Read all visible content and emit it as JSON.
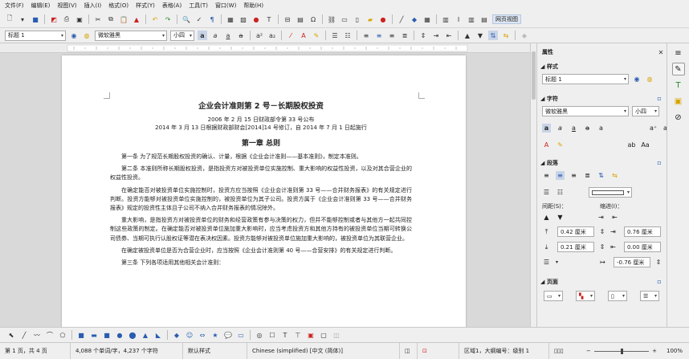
{
  "menu": [
    "文件(F)",
    "编辑(E)",
    "视图(V)",
    "插入(I)",
    "格式(O)",
    "样式(Y)",
    "表格(A)",
    "工具(T)",
    "窗口(W)",
    "帮助(H)"
  ],
  "toolbar": {
    "web_view_label": "网页视图"
  },
  "formatting": {
    "paragraph_style": "标题 1",
    "font_name": "微软雅黑",
    "font_size": "小四"
  },
  "document": {
    "title": "企业会计准则第 2 号－长期股权投资",
    "subtitle1": "2006 年 2 月 15 日财政部令第 33 号公布",
    "subtitle2": "2014 年 3 月 13 日根据财政部财会[2014]14 号修订，自 2014 年 7 月 1 日起施行",
    "chapter": "第一章 总则",
    "paragraphs": [
      "第一条 为了规范长期股权投资的确认、计量，根据《企业会计准则——基本准则》，制定本准则。",
      "第二条 本准则所称长期股权投资，是指投资方对被投资单位实施控制、重大影响的权益性投资，以及对其合营企业的权益性投资。",
      "在确定能否对被投资单位实施控制时，投资方应当按照《企业会计准则第 33 号——合并财务报表》的有关规定进行判断。投资方能够对被投资单位实施控制的，被投资单位为其子公司。投资方属于《企业会计准则第 33 号——合并财务报表》规定的投资性主体且子公司不纳入合并财务报表的情况除外。",
      "重大影响，是指投资方对被投资单位的财务和经营政策有参与决策的权力，但并不能够控制或者与其他方一起共同控制这些政策的制定。在确定能否对被投资单位施加重大影响时，应当考虑投资方和其他方持有的被投资单位当期可转换公司债券、当期可执行认股权证等潜在表决权因素。投资方能够对被投资单位施加重大影响的，被投资单位为其联营企业。",
      "在确定被投资单位是否为合营企业时，应当按照《企业会计准则第 40 号——合营安排》的有关规定进行判断。",
      "第三条 下列各项适用其他相关会计准则："
    ]
  },
  "sidebar": {
    "title": "属性",
    "styles_section": "样式",
    "style_value": "标题 1",
    "character_section": "字符",
    "font_value": "微软雅黑",
    "size_value": "小四",
    "paragraph_section": "段落",
    "spacing_label": "间距(S)：",
    "indent_label": "缩进(I)：",
    "above_value": "0.42 厘米",
    "below_value": "0.21 厘米",
    "before_indent_value": "0.76 厘米",
    "after_indent_value": "0.00 厘米",
    "first_line_value": "-0.76 厘米",
    "page_section": "页面"
  },
  "status": {
    "page": "第 1 页，共 4 页",
    "words": "4,088 个单词/字，4,237 个字符",
    "page_style": "默认样式",
    "language": "Chinese (simplified) [中文 (简体)]",
    "section": "区域1，大纲编号：级别 1",
    "zoom": "100%"
  },
  "colors": {
    "accent": "#2a5db0",
    "toolbar_bg": "#efefef",
    "doc_bg": "#d9d9d9"
  }
}
